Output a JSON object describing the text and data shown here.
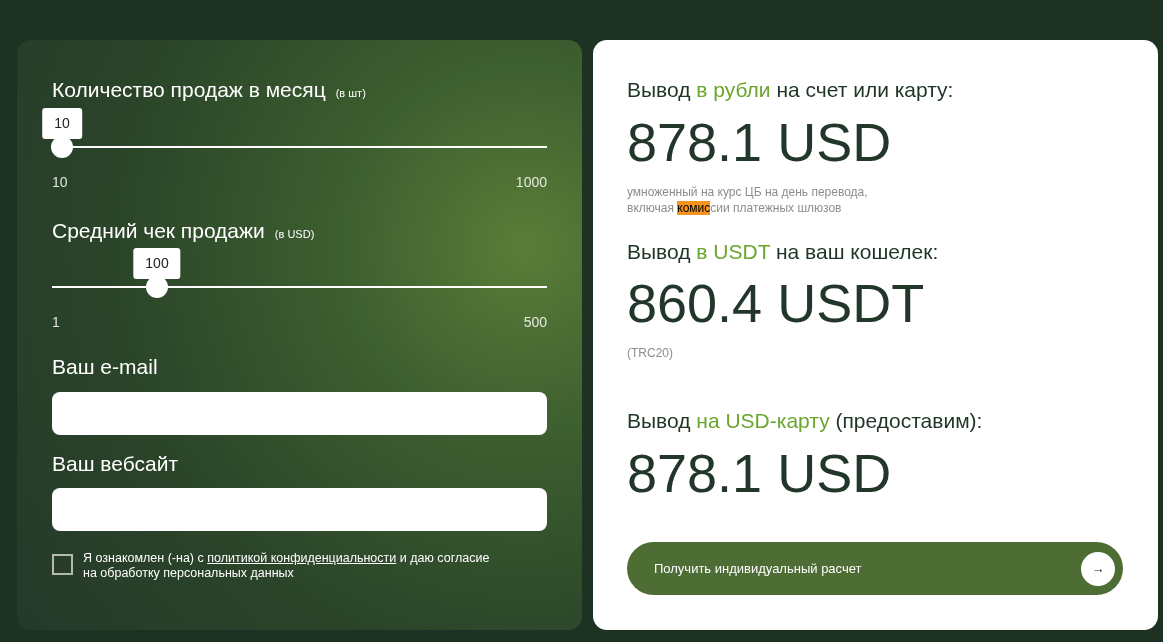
{
  "sliders": [
    {
      "label": "Количество продаж в месяц",
      "unit": "(в шт)",
      "value": "10",
      "min": "10",
      "max": "1000",
      "level": 0
    },
    {
      "label": "Средний чек продажи",
      "unit": "(в USD)",
      "value": "100",
      "min": "1",
      "max": "500",
      "level": 0.2
    }
  ],
  "fields": [
    {
      "label": "Ваш e-mail"
    },
    {
      "label": "Ваш вебсайт"
    }
  ],
  "consent": {
    "checked": false,
    "before": "Я ознакомлен (-на) с ",
    "link": "политикой конфиденциальности",
    "after": " и даю согласие на обработку персональных данных"
  },
  "results": [
    {
      "title": [
        {
          "text": "Вывод ",
          "accent": false
        },
        {
          "text": "в рубли",
          "accent": true
        },
        {
          "text": " на счет или карту:",
          "accent": false
        }
      ],
      "amount": "878.1 USD",
      "note": [
        {
          "text": "умноженный на курс ЦБ на день перевода,\nвключая ",
          "highlighted": false
        },
        {
          "text": "комис",
          "highlighted": true
        },
        {
          "text": "сии платежных шлюзов",
          "highlighted": false
        }
      ]
    },
    {
      "title": [
        {
          "text": "Вывод ",
          "accent": false
        },
        {
          "text": "в USDT",
          "accent": true
        },
        {
          "text": " на ваш кошелек:",
          "accent": false
        }
      ],
      "amount": "860.4 USDT",
      "note": [
        {
          "text": "(TRC20)",
          "highlighted": false
        }
      ]
    },
    {
      "title": [
        {
          "text": "Вывод ",
          "accent": false
        },
        {
          "text": "на USD-карту",
          "accent": true
        },
        {
          "text": " (предоставим):",
          "accent": false
        }
      ],
      "amount": "878.1 USD"
    }
  ],
  "cta": {
    "label": "Получить индивидуальный расчет",
    "icon": "→"
  }
}
